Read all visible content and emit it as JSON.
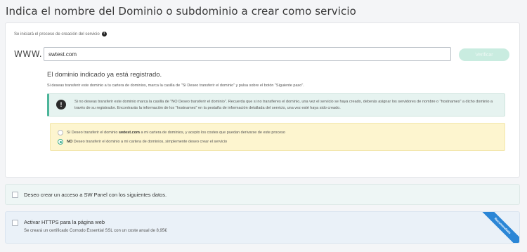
{
  "page": {
    "title": "Indica el nombre del Dominio o subdominio a crear como servicio"
  },
  "domain_form": {
    "info_text": "Se iniciará el proceso de creación del servicio",
    "www_label": "WWW.",
    "domain_value": "swtest.com",
    "verify_label": "Verificar"
  },
  "result": {
    "title": "El dominio indicado ya está registrado.",
    "subtitle": "Si deseas transferir este dominio a tu cartera de dominios, marca la casilla de \"Sí Deseo transferir el dominio\" y pulsa sobre el botón \"Siguiente paso\".",
    "alert_text": "Si no deseas transferir este dominio marca la casilla de \"NO Deseo transferir el dominio\". Recuerda que si no transfieres el dominio, una vez el servicio se haya creado, deberás asignar los servidores de nombre o \"hostnames\" a dicho dominio a través de su registrador. Encontrarás la información de los \"hostnames\" en la pestaña de información detallada del servicio, una vez esté haya sido creado.",
    "option_yes_prefix": "Sí Deseo transferir el dominio",
    "option_yes_domain": "swtest.com",
    "option_yes_suffix": "a mi cartera de dominios, y acepto los costes que puedan derivarse de este proceso",
    "option_no_prefix": "NO",
    "option_no_suffix": "Deseo transferir el dominio a mi cartera de dominios, simplemente deseo crear el servicio",
    "selected_option": "no"
  },
  "sw_panel": {
    "label": "Deseo crear un acceso a SW Panel con los siguientes datos."
  },
  "https": {
    "label": "Activar HTTPS para la página web",
    "sub": "Se creará un certificado Comodo Essential SSL con un coste anual de 8,95€",
    "ribbon": "Recomendado"
  },
  "colors": {
    "accent": "#3dad8f",
    "alert_bg": "#e6f3f0",
    "warning_bg": "#fdf5cf",
    "ribbon": "#2b86d6"
  }
}
